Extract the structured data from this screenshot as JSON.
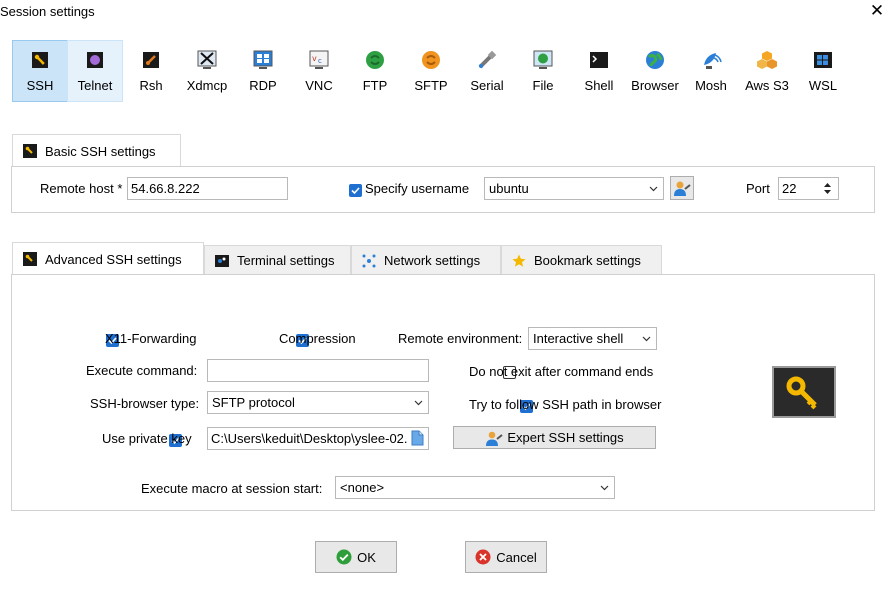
{
  "window": {
    "title": "Session settings",
    "close_glyph": "✕"
  },
  "protocols": [
    {
      "label": "SSH",
      "icon": "ssh-icon",
      "selected": true
    },
    {
      "label": "Telnet",
      "icon": "telnet-icon"
    },
    {
      "label": "Rsh",
      "icon": "rsh-icon"
    },
    {
      "label": "Xdmcp",
      "icon": "xdmcp-icon"
    },
    {
      "label": "RDP",
      "icon": "rdp-icon"
    },
    {
      "label": "VNC",
      "icon": "vnc-icon"
    },
    {
      "label": "FTP",
      "icon": "ftp-icon"
    },
    {
      "label": "SFTP",
      "icon": "sftp-icon"
    },
    {
      "label": "Serial",
      "icon": "serial-icon"
    },
    {
      "label": "File",
      "icon": "file-icon"
    },
    {
      "label": "Shell",
      "icon": "shell-icon"
    },
    {
      "label": "Browser",
      "icon": "browser-icon"
    },
    {
      "label": "Mosh",
      "icon": "mosh-icon"
    },
    {
      "label": "Aws S3",
      "icon": "aws-s3-icon"
    },
    {
      "label": "WSL",
      "icon": "wsl-icon"
    }
  ],
  "basic": {
    "tab_label": "Basic SSH settings",
    "remote_host_label": "Remote host *",
    "remote_host_value": "54.66.8.222",
    "specify_username_label": "Specify username",
    "specify_username_checked": true,
    "username_value": "ubuntu",
    "port_label": "Port",
    "port_value": "22"
  },
  "advanced_tabs": [
    {
      "label": "Advanced SSH settings",
      "icon": "wrench-icon",
      "active": true
    },
    {
      "label": "Terminal settings",
      "icon": "terminal-icon"
    },
    {
      "label": "Network settings",
      "icon": "network-icon"
    },
    {
      "label": "Bookmark settings",
      "icon": "star-icon"
    }
  ],
  "advanced": {
    "x11_label": "X11-Forwarding",
    "x11_checked": true,
    "compression_label": "Compression",
    "compression_checked": true,
    "remote_env_label": "Remote environment:",
    "remote_env_value": "Interactive shell",
    "execute_command_label": "Execute command:",
    "execute_command_value": "",
    "do_not_exit_label": "Do not exit after command ends",
    "do_not_exit_checked": false,
    "ssh_browser_label": "SSH-browser type:",
    "ssh_browser_value": "SFTP protocol",
    "follow_path_label": "Try to follow SSH path in browser",
    "follow_path_checked": true,
    "private_key_label": "Use private key",
    "private_key_checked": true,
    "private_key_value": "C:\\Users\\keduit\\Desktop\\yslee-02.",
    "expert_button": "Expert SSH settings",
    "macro_label": "Execute macro at session start:",
    "macro_value": "<none>"
  },
  "buttons": {
    "ok": "OK",
    "cancel": "Cancel"
  },
  "colors": {
    "accent": "#1f6fd1",
    "selected_bg": "#cce4f7",
    "ok_green": "#2e9e3a",
    "cancel_red": "#d9342b"
  }
}
